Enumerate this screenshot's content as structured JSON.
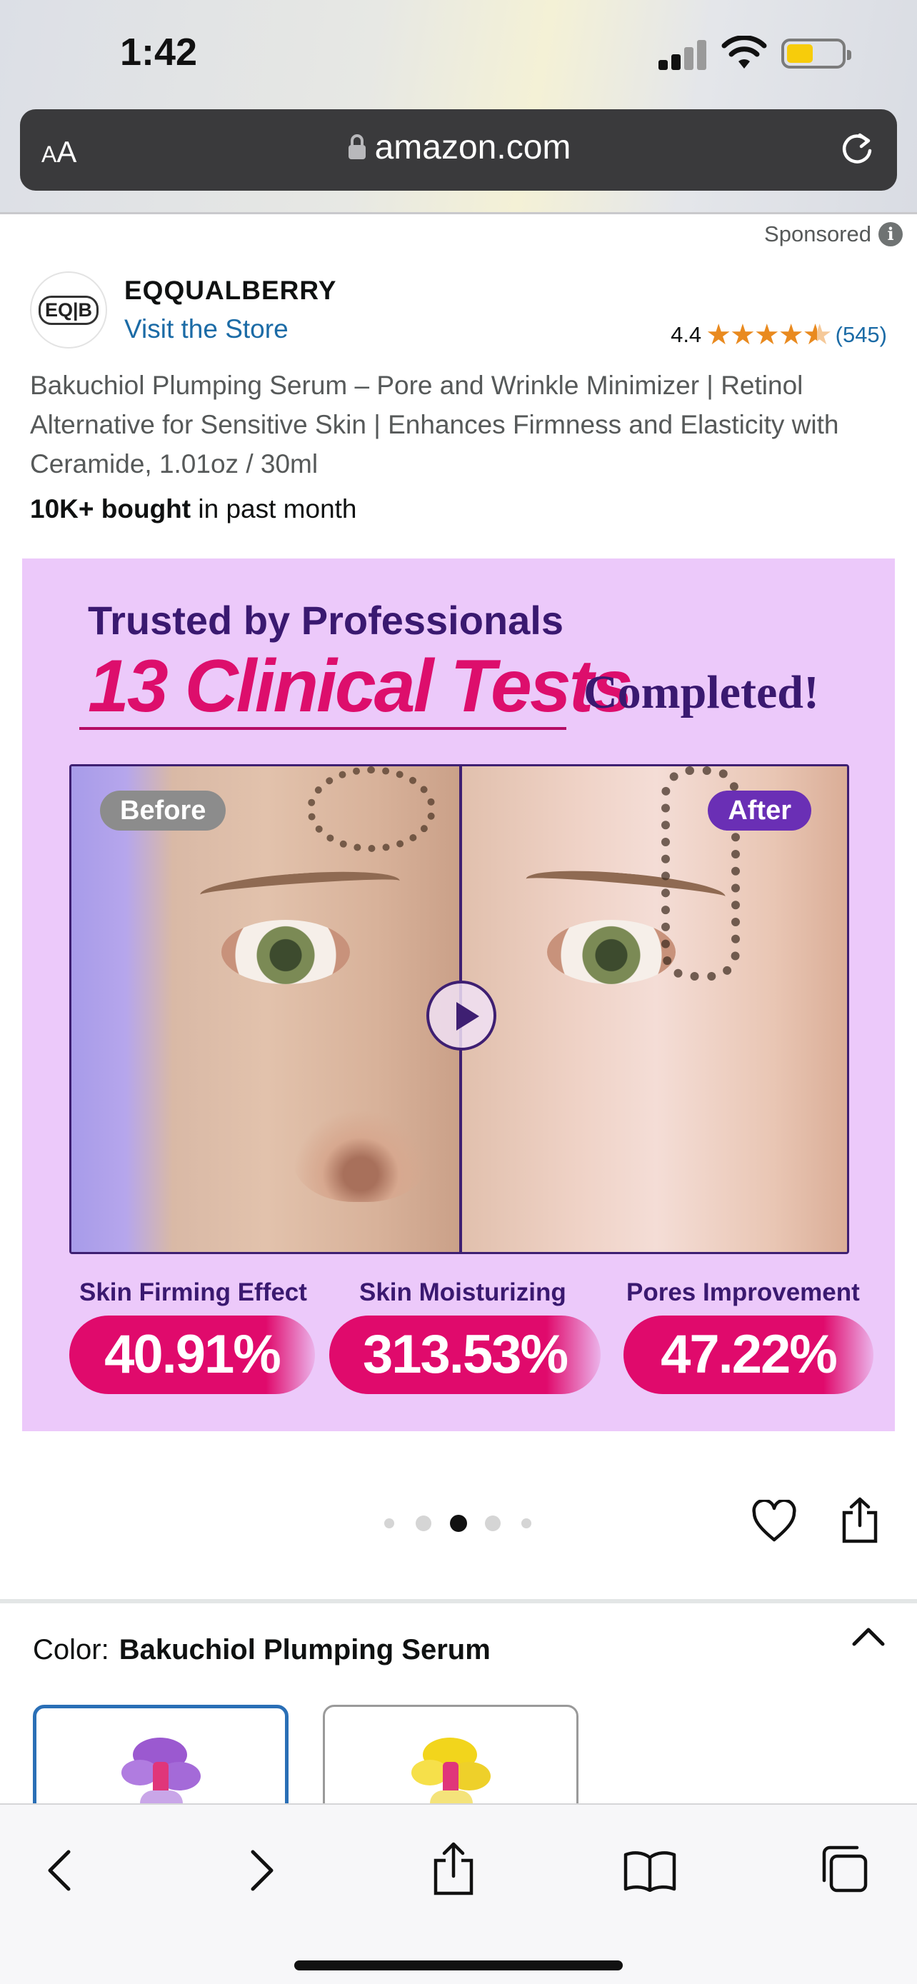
{
  "status_bar": {
    "time": "1:42"
  },
  "browser": {
    "text_size_label": "AA",
    "url": "amazon.com"
  },
  "sponsored_label": "Sponsored",
  "product": {
    "brand": "EQQUALBERRY",
    "logo_text": "EQ|B",
    "store_link": "Visit the Store",
    "rating": "4.4",
    "review_count": "(545)",
    "title": "Bakuchiol Plumping Serum – Pore and Wrinkle Minimizer | Retinol Alternative for Sensitive Skin | Enhances Firmness and Elasticity with Ceramide, 1.01oz / 30ml",
    "bought_bold": "10K+ bought",
    "bought_rest": " in past month"
  },
  "hero_image": {
    "subtitle": "Trusted by Professionals",
    "headline": "13 Clinical Tests",
    "headline_suffix": "Completed!",
    "before_label": "Before",
    "after_label": "After",
    "stats": [
      {
        "label": "Skin Firming Effect",
        "value": "40.91%"
      },
      {
        "label": "Skin Moisturizing",
        "value": "313.53%"
      },
      {
        "label": "Pores Improvement",
        "value": "47.22%"
      }
    ]
  },
  "carousel": {
    "total_dots": 5,
    "active_index": 2
  },
  "color_selector": {
    "label": "Color:",
    "value": "Bakuchiol Plumping Serum"
  },
  "colors": {
    "accent": "#dd0e6c",
    "link": "#1b6ba6",
    "hero_bg": "#ecc9fa",
    "star": "#e98a1f"
  }
}
